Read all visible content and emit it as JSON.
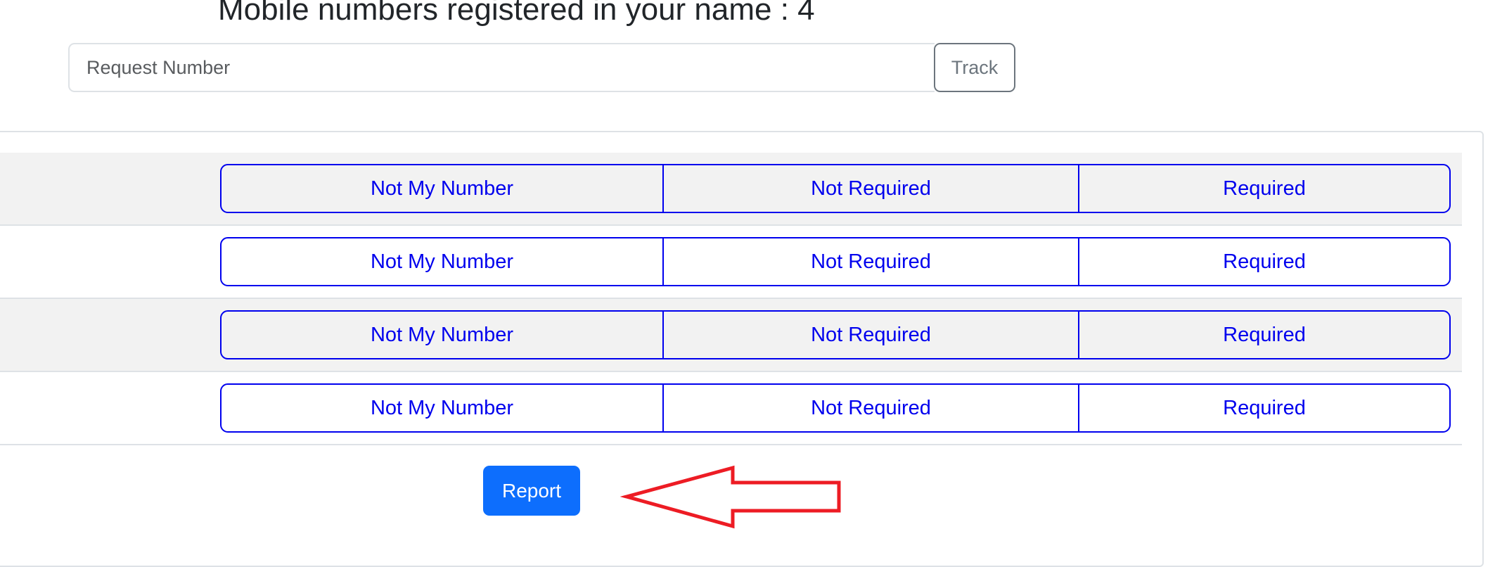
{
  "header": {
    "title": "Mobile numbers registered in your name : 4"
  },
  "tracker": {
    "input_value": "",
    "input_placeholder": "Request Number",
    "track_label": "Track"
  },
  "numbers": {
    "rows": [
      {
        "number": "",
        "options": [
          "Not My Number",
          "Not Required",
          "Required"
        ]
      },
      {
        "number": "",
        "options": [
          "Not My Number",
          "Not Required",
          "Required"
        ]
      },
      {
        "number": "",
        "options": [
          "Not My Number",
          "Not Required",
          "Required"
        ]
      },
      {
        "number": "",
        "options": [
          "Not My Number",
          "Not Required",
          "Required"
        ]
      }
    ]
  },
  "actions": {
    "report_label": "Report"
  },
  "annotation": {
    "icon": "left-arrow-icon",
    "color": "#ed1c24"
  },
  "colors": {
    "option_text": "#0000ee",
    "primary": "#0d6efd",
    "stripe": "#f2f2f2"
  }
}
